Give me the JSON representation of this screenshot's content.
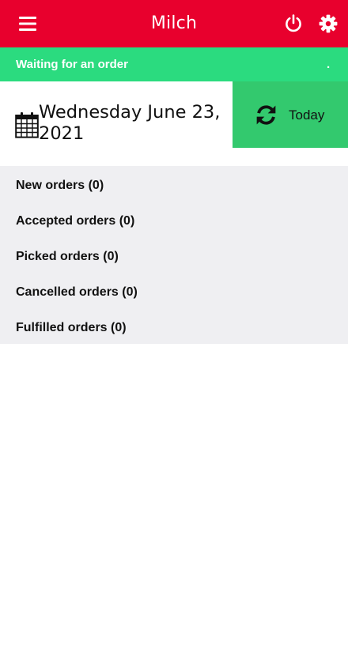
{
  "header": {
    "title": "Milch",
    "icons": [
      "menu-icon",
      "power-icon",
      "gear-icon"
    ],
    "color": "#e8002d"
  },
  "status": {
    "text": "Waiting for an order",
    "indicator": ".",
    "color": "#2bdb7f"
  },
  "date_bar": {
    "date_text": "Wednesday June 23, 2021",
    "today_label": "Today",
    "today_color": "#33c96e",
    "icons": [
      "calendar-icon",
      "refresh-icon"
    ]
  },
  "orders": {
    "background": "#efeff2",
    "items": [
      {
        "key": "new",
        "label": "New orders (0)"
      },
      {
        "key": "accepted",
        "label": "Accepted orders (0)"
      },
      {
        "key": "picked",
        "label": "Picked orders (0)"
      },
      {
        "key": "cancelled",
        "label": "Cancelled orders (0)"
      },
      {
        "key": "fulfilled",
        "label": "Fulfilled orders (0)"
      }
    ]
  }
}
